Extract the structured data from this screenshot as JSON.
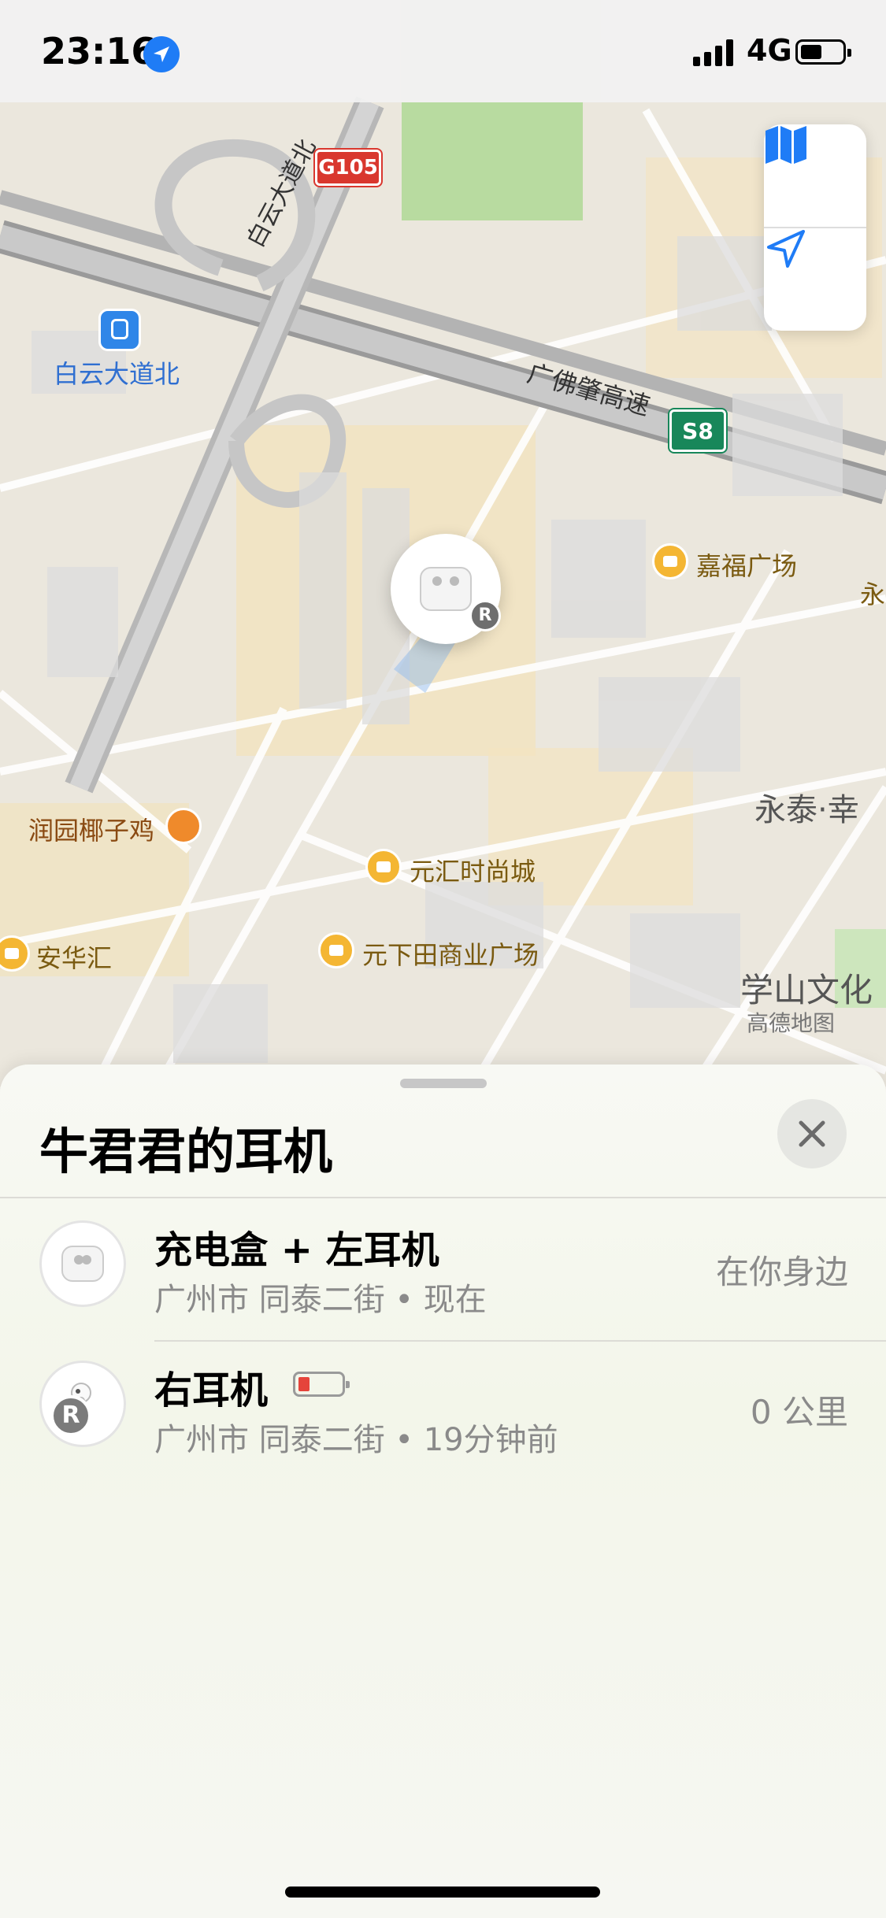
{
  "status_bar": {
    "time": "23:16",
    "network": "4G",
    "icons": [
      "location-arrow-icon",
      "cellular-signal-icon",
      "battery-icon"
    ]
  },
  "map": {
    "road_labels": [
      "白云大道北",
      "广佛肇高速"
    ],
    "shields": [
      "G105",
      "S8"
    ],
    "metro_station": "白云大道北",
    "pois": [
      "嘉福广场",
      "永",
      "润园椰子鸡",
      "元汇时尚城",
      "元下田商业广场",
      "安华汇"
    ],
    "areas": [
      "永泰·幸",
      "学山文化"
    ],
    "attribution": "高德地图",
    "controls": [
      "map-mode-icon",
      "locate-me-icon"
    ],
    "marker_badge": "R"
  },
  "sheet": {
    "title": "牛君君的耳机",
    "rows": [
      {
        "name": "充电盒 + 左耳机",
        "location": "广州市 同泰二街 • 现在",
        "distance": "在你身边"
      },
      {
        "name": "右耳机",
        "location": "广州市 同泰二街 • 19分钟前",
        "distance": "0 公里",
        "badge": "R",
        "battery_level": 0.2
      }
    ]
  },
  "colors": {
    "accent_blue": "#1f7cf6",
    "poi_orange": "#f4b633",
    "battery_low": "#e5443b"
  }
}
